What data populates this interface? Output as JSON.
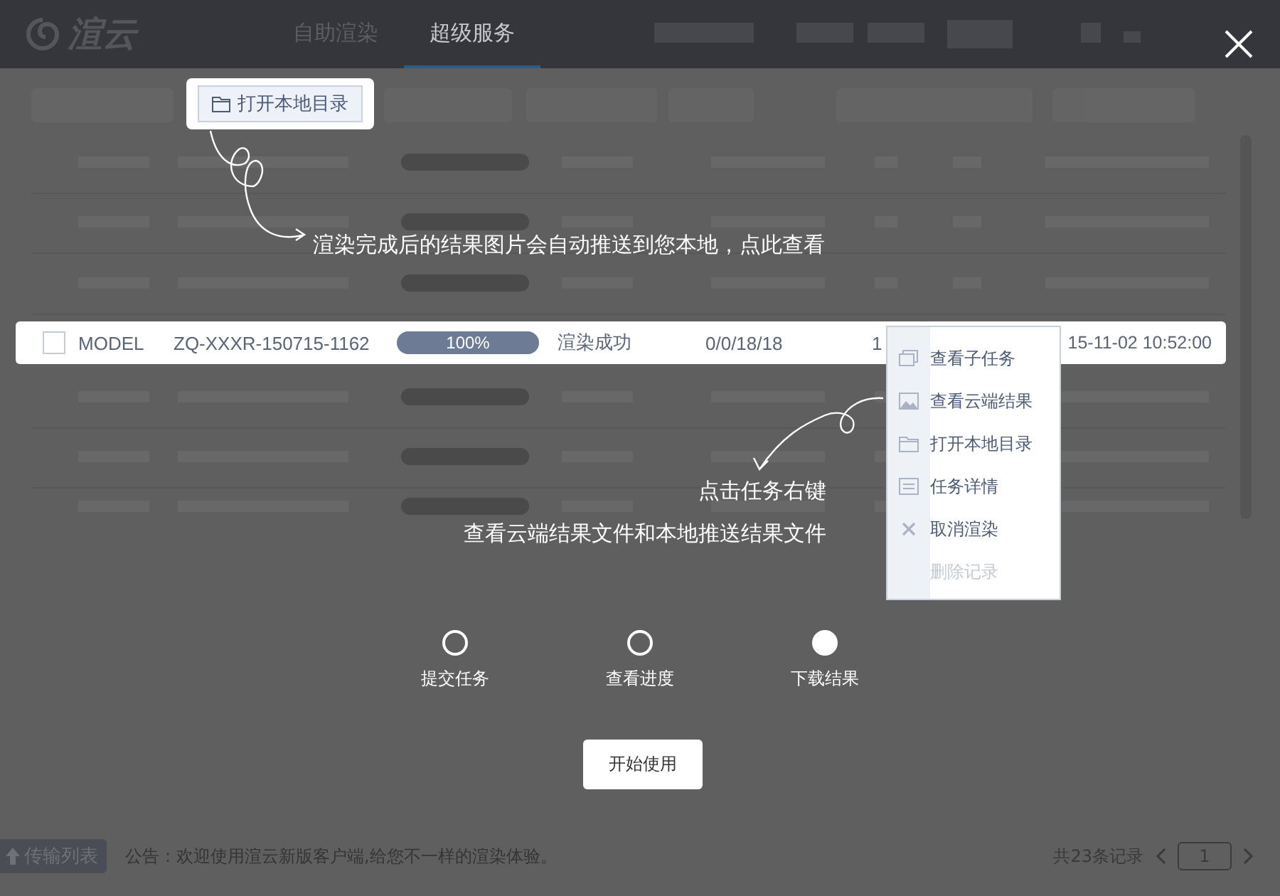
{
  "header": {
    "logo": "渲云",
    "tabs": [
      {
        "label": "自助渲染",
        "selected": false
      },
      {
        "label": "超级服务",
        "selected": true
      }
    ]
  },
  "guide_callout": {
    "button": "打开本地目录",
    "caption": "渲染完成后的结果图片会自动推送到您本地，点此查看"
  },
  "highlighted_row": {
    "checked": false,
    "name": "MODEL",
    "task_id": "ZQ-XXXR-150715-1162",
    "progress": {
      "level": 1,
      "label": "100%"
    },
    "status": "渲染成功",
    "frames": "0/0/18/18",
    "column_6": "1",
    "time": "15-11-02 10:52:00"
  },
  "context_menu": [
    {
      "label": "查看子任务",
      "disabled": false
    },
    {
      "label": "查看云端结果",
      "disabled": false
    },
    {
      "label": "打开本地目录",
      "disabled": false
    },
    {
      "label": "任务详情",
      "disabled": false
    },
    {
      "label": "取消渲染",
      "disabled": false
    },
    {
      "label": "删除记录",
      "disabled": true
    }
  ],
  "menu_hint": [
    "点击任务右键",
    "查看云端结果文件和本地推送结果文件"
  ],
  "steps": [
    {
      "label": "提交任务",
      "selected": false
    },
    {
      "label": "查看进度",
      "selected": false
    },
    {
      "label": "下载结果",
      "selected": true
    }
  ],
  "start_button": "开始使用",
  "footer": {
    "transfer_button": "传输列表",
    "notice": "公告：欢迎使用渲云新版客户端,给您不一样的渲染体验。",
    "record_count": "共23条记录",
    "page": "1"
  }
}
